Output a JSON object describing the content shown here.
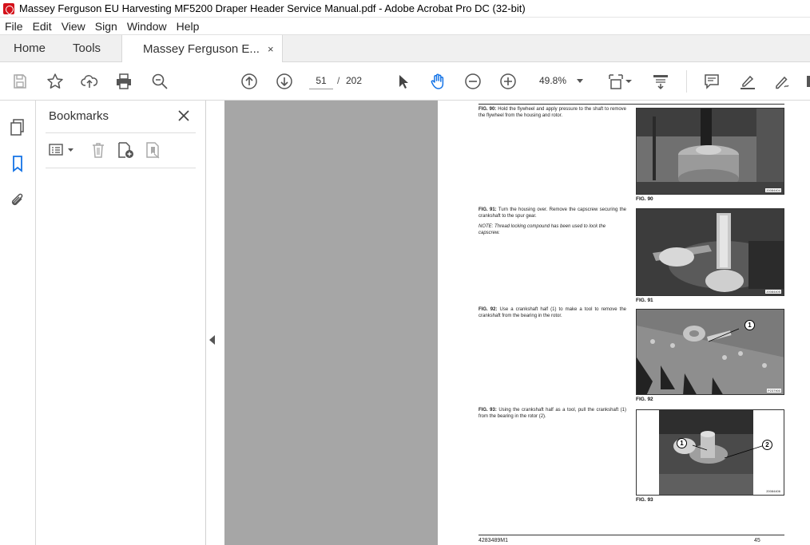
{
  "window": {
    "title": "Massey Ferguson EU Harvesting MF5200 Draper Header Service Manual.pdf - Adobe Acrobat Pro DC (32-bit)"
  },
  "menu": [
    "File",
    "Edit",
    "View",
    "Sign",
    "Window",
    "Help"
  ],
  "tabs": {
    "home": "Home",
    "tools": "Tools",
    "document": "Massey Ferguson E...",
    "close_glyph": "×"
  },
  "toolbar": {
    "current_page": "51",
    "page_separator": "/",
    "total_pages": "202",
    "zoom": "49.8%"
  },
  "bookmarks": {
    "title": "Bookmarks",
    "close_glyph": "✕"
  },
  "document_page": {
    "footer_left": "4283489M1",
    "footer_right": "45",
    "figures": [
      {
        "ref": "FIG. 90:",
        "text": "Hold the flywheel and apply pressure to the shaft to remove the flywheel from the housing and rotor.",
        "note": "",
        "label": "FIG. 90",
        "photo_id": "20084404"
      },
      {
        "ref": "FIG. 91:",
        "text": "Turn the housing over. Remove the capscrew securing the crankshaft to the spur gear.",
        "note": "NOTE: Thread locking compound has been used to lock the capscrew.",
        "label": "FIG. 91",
        "photo_id": "20084405"
      },
      {
        "ref": "FIG. 92:",
        "text": "Use a crankshaft half (1) to make a tool to remove the crankshaft from the bearing in the rotor.",
        "note": "",
        "label": "FIG. 92",
        "photo_id": "P237900",
        "callouts": [
          "1"
        ]
      },
      {
        "ref": "FIG. 93:",
        "text": "Using the crankshaft half as a tool, pull the crankshaft (1) from the bearing in the rotor (2).",
        "note": "",
        "label": "FIG. 93",
        "photo_id": "20084406",
        "callouts": [
          "1",
          "2"
        ]
      }
    ]
  },
  "colors": {
    "accent_blue": "#1473e6",
    "canvas_gray": "#a6a6a6",
    "acrobat_red": "#d4121b"
  }
}
